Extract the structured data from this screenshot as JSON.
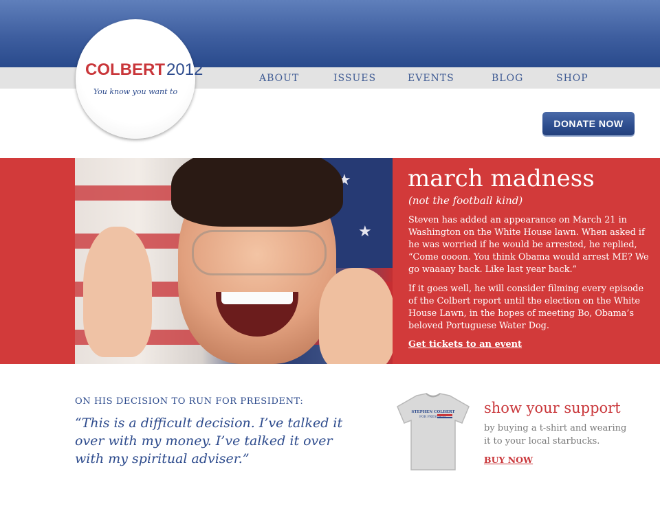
{
  "header": {
    "logo": {
      "name": "COLBERT",
      "year": "2012",
      "tagline": "You know you want to"
    },
    "nav": [
      "ABOUT",
      "ISSUES",
      "EVENTS",
      "BLOG",
      "SHOP"
    ],
    "donate_label": "DONATE NOW"
  },
  "hero": {
    "title": "march madness",
    "subtitle": "(not the football kind)",
    "paragraphs": [
      "Steven has added an appearance on March 21 in Washington on the White House lawn. When asked if he was worried if he would be arrested, he replied, “Come oooon. You think Obama would arrest ME? We go waaaay back. Like last year back.”",
      "If it goes well, he will consider filming every episode of the Colbert report until the election on the White House Lawn, in the hopes of meeting Bo, Obama’s beloved Portuguese Water Dog."
    ],
    "link": "Get tickets to an event"
  },
  "quote": {
    "label": "ON HIS DECISION TO RUN FOR PRESIDENT:",
    "text": "“This is a difficult decision. I’ve talked it over with my money. I’ve talked it over with my spiritual adviser.”"
  },
  "support": {
    "title": "show your support",
    "text": "by buying a t-shirt and wearing it to your local starbucks.",
    "link": "BUY NOW",
    "tshirt_print": [
      "STEPHEN COLBERT",
      "FOR PRESIDENT"
    ]
  },
  "colors": {
    "brand_blue": "#2c4a8c",
    "brand_red": "#c9363a",
    "hero_red": "#d23a3a"
  }
}
